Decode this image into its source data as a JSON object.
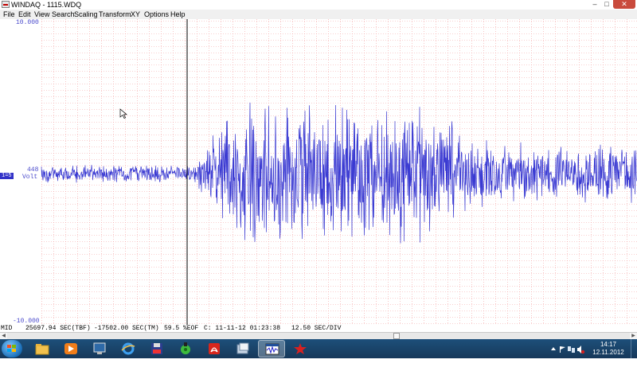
{
  "window": {
    "title": "WINDAQ - 1115.WDQ",
    "controls": {
      "minimize": "–",
      "maximize": "□",
      "close": "✕"
    }
  },
  "menu": [
    "File",
    "Edit",
    "View",
    "Search",
    "Scaling",
    "Transform",
    "XY",
    "Options",
    "Help"
  ],
  "plot": {
    "y_top_label": "10.000",
    "y_bottom_label": "-10.000",
    "channel_value": "448",
    "channel_unit": "Volt",
    "channel_badge": "1=5",
    "trace_color": "#3a3ad2",
    "grid_color": "#f4a0a0",
    "cursor_color": "#000000"
  },
  "chart_data": {
    "type": "line",
    "title": "",
    "ylabel": "Volt",
    "ylim": [
      -10,
      10
    ],
    "x_scale": "12.50 SEC/DIV",
    "series": [
      {
        "name": "",
        "description_points": []
      }
    ]
  },
  "status": {
    "mode": "MID",
    "tbf": "25697.94 SEC(TBF)",
    "tm": "-17502.00 SEC(TM)",
    "eof": "59.5 %EOF",
    "channel_time": "C: 11-11-12 01:23:38",
    "secdiv": "12.50 SEC/DIV"
  },
  "scrollbar": {
    "left_arrow": "◀",
    "right_arrow": "▶",
    "position": 0.62
  },
  "taskbar": {
    "apps": [
      "windows-explorer",
      "media-player",
      "windaq-monitor",
      "internet-explorer",
      "save-disk",
      "green-utility",
      "pdf-reader",
      "file-copy",
      "windaq-waveform",
      "red-tool"
    ],
    "active_app": "windaq-waveform",
    "time": "14:17",
    "date": "12.11.2012"
  }
}
